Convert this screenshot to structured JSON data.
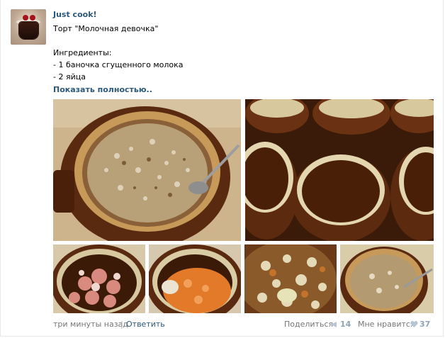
{
  "post": {
    "author": "Just cook!",
    "title": "Торт \"Молочная девочка\"",
    "ingredients_heading": "Ингредиенты:",
    "ingredients": [
      "- 1 баночка сгущенного молока",
      "- 2 яйца"
    ],
    "show_more": "Показать полностью.."
  },
  "footer": {
    "time": "три минуты назад",
    "separator": "|",
    "reply": "Ответить",
    "share_label": "Поделиться",
    "share_count": "14",
    "like_label": "Мне нравится",
    "like_count": "37"
  },
  "icons": {
    "share": "megaphone-icon",
    "like": "heart-icon"
  },
  "colors": {
    "link": "#2b587a",
    "muted": "#777777",
    "count": "#8ea4bb"
  }
}
